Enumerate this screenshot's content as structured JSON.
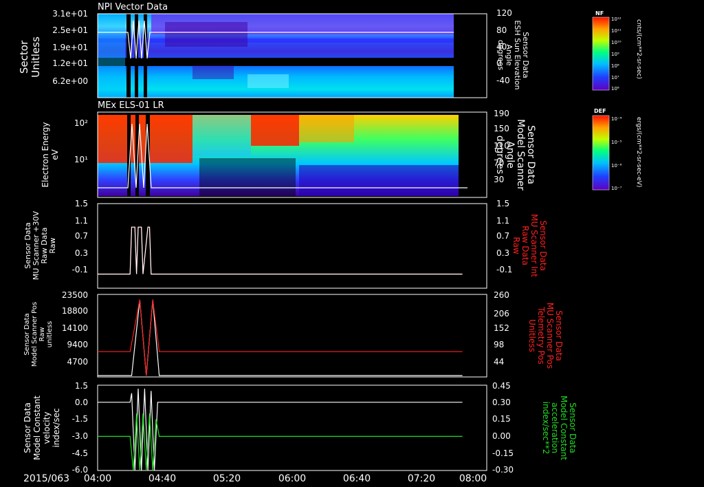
{
  "time_axis": {
    "date_label": "2015/063",
    "ticks": [
      "04:00",
      "04:40",
      "05:20",
      "06:00",
      "06:40",
      "07:20",
      "08:00"
    ]
  },
  "panels": {
    "p1": {
      "title": "NPI Vector Data",
      "left_axis_label": [
        "Sector",
        "Unitless"
      ],
      "left_ticks": [
        "3.1e+01",
        "2.5e+01",
        "1.9e+01",
        "1.2e+01",
        "6.2e+00"
      ],
      "right_ticks": [
        "120",
        "80",
        "40",
        "0",
        "-40"
      ],
      "right_label": [
        "Sensor Data",
        "ESH Sun Elevation",
        "Angle",
        "degrees"
      ],
      "colorbar": {
        "title": "NF",
        "unit": "cnts/(cm**2-sr-sec)",
        "ticks": [
          "10¹²",
          "10¹¹",
          "10¹⁰",
          "10⁹",
          "10⁸",
          "10⁷",
          "10⁶"
        ]
      }
    },
    "p2": {
      "title": "MEx ELS-01 LR",
      "left_axis_label": [
        "Electron Energy",
        "eV"
      ],
      "left_ticks": [
        "10²",
        "10¹"
      ],
      "right_ticks": [
        "190",
        "150",
        "110",
        "70",
        "30"
      ],
      "right_label": [
        "Sensor Data",
        "Model Scanner",
        "Angle",
        "degrees"
      ],
      "colorbar": {
        "title": "DEF",
        "unit": "ergs/(cm**2-sr-sec-eV)",
        "ticks": [
          "10⁻⁴",
          "10⁻⁵",
          "10⁻⁶",
          "10⁻⁷"
        ]
      }
    },
    "p3": {
      "left_ticks": [
        "1.5",
        "1.1",
        "0.7",
        "0.3",
        "-0.1"
      ],
      "right_ticks": [
        "1.5",
        "1.1",
        "0.7",
        "0.3",
        "-0.1"
      ],
      "left_label": [
        "Sensor Data",
        "MU Scanner +30V",
        "Raw Data",
        "Raw"
      ],
      "right_label": [
        "Sensor Data",
        "MU Scanner Int",
        "Raw Data",
        "Raw"
      ]
    },
    "p4": {
      "left_ticks": [
        "23500",
        "18800",
        "14100",
        "9400",
        "4700"
      ],
      "right_ticks": [
        "260",
        "206",
        "152",
        "98",
        "44"
      ],
      "left_label": [
        "Sensor Data",
        "Model Scanner Pos",
        "Raw",
        "unitless"
      ],
      "right_label": [
        "Sensor Data",
        "MU Scanner Pos",
        "Telemetry Pos",
        "Unitless"
      ]
    },
    "p5": {
      "left_ticks": [
        "1.5",
        "0.0",
        "-1.5",
        "-3.0",
        "-4.5",
        "-6.0"
      ],
      "right_ticks": [
        "0.45",
        "0.30",
        "0.15",
        "0.00",
        "-0.15",
        "-0.30"
      ],
      "left_label": [
        "Sensor Data",
        "Model Constant",
        "velocity",
        "index/sec"
      ],
      "right_label": [
        "Sensor Data",
        "Model Constant",
        "acceleration",
        "index/sec**2"
      ]
    }
  },
  "colors": {
    "background": "#000000",
    "axis": "#ffffff",
    "red_trace": "#ff2020",
    "green_trace": "#22dd22",
    "white_trace": "#ffffff"
  },
  "chart_data": [
    {
      "type": "heatmap",
      "title": "NPI Vector Data",
      "x_range": [
        "04:00",
        "08:00"
      ],
      "data_end": "07:37",
      "ylabel": "Sector Unitless",
      "y_ticks": [
        31,
        25,
        19,
        12,
        6.2
      ],
      "overlay_line": {
        "name": "ESH Sun Elevation Angle",
        "units": "degrees",
        "range": [
          -60,
          120
        ],
        "steady_value": 74
      }
    },
    {
      "type": "heatmap",
      "title": "MEx ELS-01 LR",
      "x_range": [
        "04:00",
        "08:00"
      ],
      "data_end": "07:37",
      "ylabel": "Electron Energy eV",
      "y_scale": "log",
      "y_ticks": [
        100,
        10
      ],
      "overlay_line": {
        "name": "Model Scanner Angle",
        "units": "degrees",
        "range": [
          0,
          190
        ],
        "steady_value": 16
      }
    },
    {
      "type": "line",
      "ylim": [
        -0.3,
        1.5
      ],
      "series": [
        {
          "color": "#ff2020",
          "x": [
            "04:00",
            "04:20",
            "04:21",
            "04:23",
            "04:24",
            "04:25",
            "04:27",
            "04:28",
            "04:31",
            "04:32",
            "04:33",
            "07:45"
          ],
          "values": [
            0.0,
            0.0,
            1.0,
            1.0,
            0.0,
            1.0,
            1.0,
            0.0,
            1.0,
            1.0,
            0.0,
            0.0
          ]
        },
        {
          "color": "#ffffff",
          "x": [
            "04:00",
            "04:20",
            "04:21",
            "04:23",
            "04:24",
            "04:25",
            "04:27",
            "04:28",
            "04:31",
            "04:32",
            "04:33",
            "07:45"
          ],
          "values": [
            0.0,
            0.0,
            1.0,
            1.0,
            0.0,
            1.0,
            1.0,
            0.0,
            1.0,
            1.0,
            0.0,
            0.0
          ]
        }
      ]
    },
    {
      "type": "line",
      "ylim": [
        0,
        23500
      ],
      "y2lim": [
        0,
        260
      ],
      "series": [
        {
          "color": "#ffffff",
          "x": [
            "04:00",
            "04:21",
            "04:26",
            "04:30",
            "04:34",
            "04:38",
            "07:45"
          ],
          "values": [
            400,
            400,
            22000,
            400,
            22000,
            400,
            400
          ]
        },
        {
          "color": "#ff2020",
          "x": [
            "04:00",
            "04:20",
            "04:26",
            "04:30",
            "04:34",
            "04:38",
            "07:45"
          ],
          "values": [
            7200,
            7200,
            22000,
            400,
            22000,
            7200,
            7200
          ]
        }
      ]
    },
    {
      "type": "line",
      "ylim": [
        -6.0,
        1.5
      ],
      "y2lim": [
        -0.3,
        0.45
      ],
      "series": [
        {
          "color": "#ffffff",
          "x": [
            "04:00",
            "04:20",
            "04:21",
            "04:23",
            "04:25",
            "04:27",
            "04:29",
            "04:31",
            "04:33",
            "04:35",
            "04:37",
            "07:45"
          ],
          "values": [
            0.0,
            0.0,
            0.8,
            -6.0,
            1.2,
            -6.0,
            1.2,
            -6.0,
            1.0,
            -6.0,
            0.0,
            0.0
          ]
        },
        {
          "color": "#22dd22",
          "x": [
            "04:00",
            "04:20",
            "04:22",
            "04:24",
            "04:26",
            "04:28",
            "04:30",
            "04:32",
            "04:34",
            "04:36",
            "04:38",
            "07:45"
          ],
          "values": [
            -3.0,
            -3.0,
            -6.0,
            -1.0,
            -6.0,
            -1.0,
            -6.0,
            -1.0,
            -6.0,
            -1.5,
            -3.0,
            -3.0
          ]
        }
      ]
    }
  ]
}
